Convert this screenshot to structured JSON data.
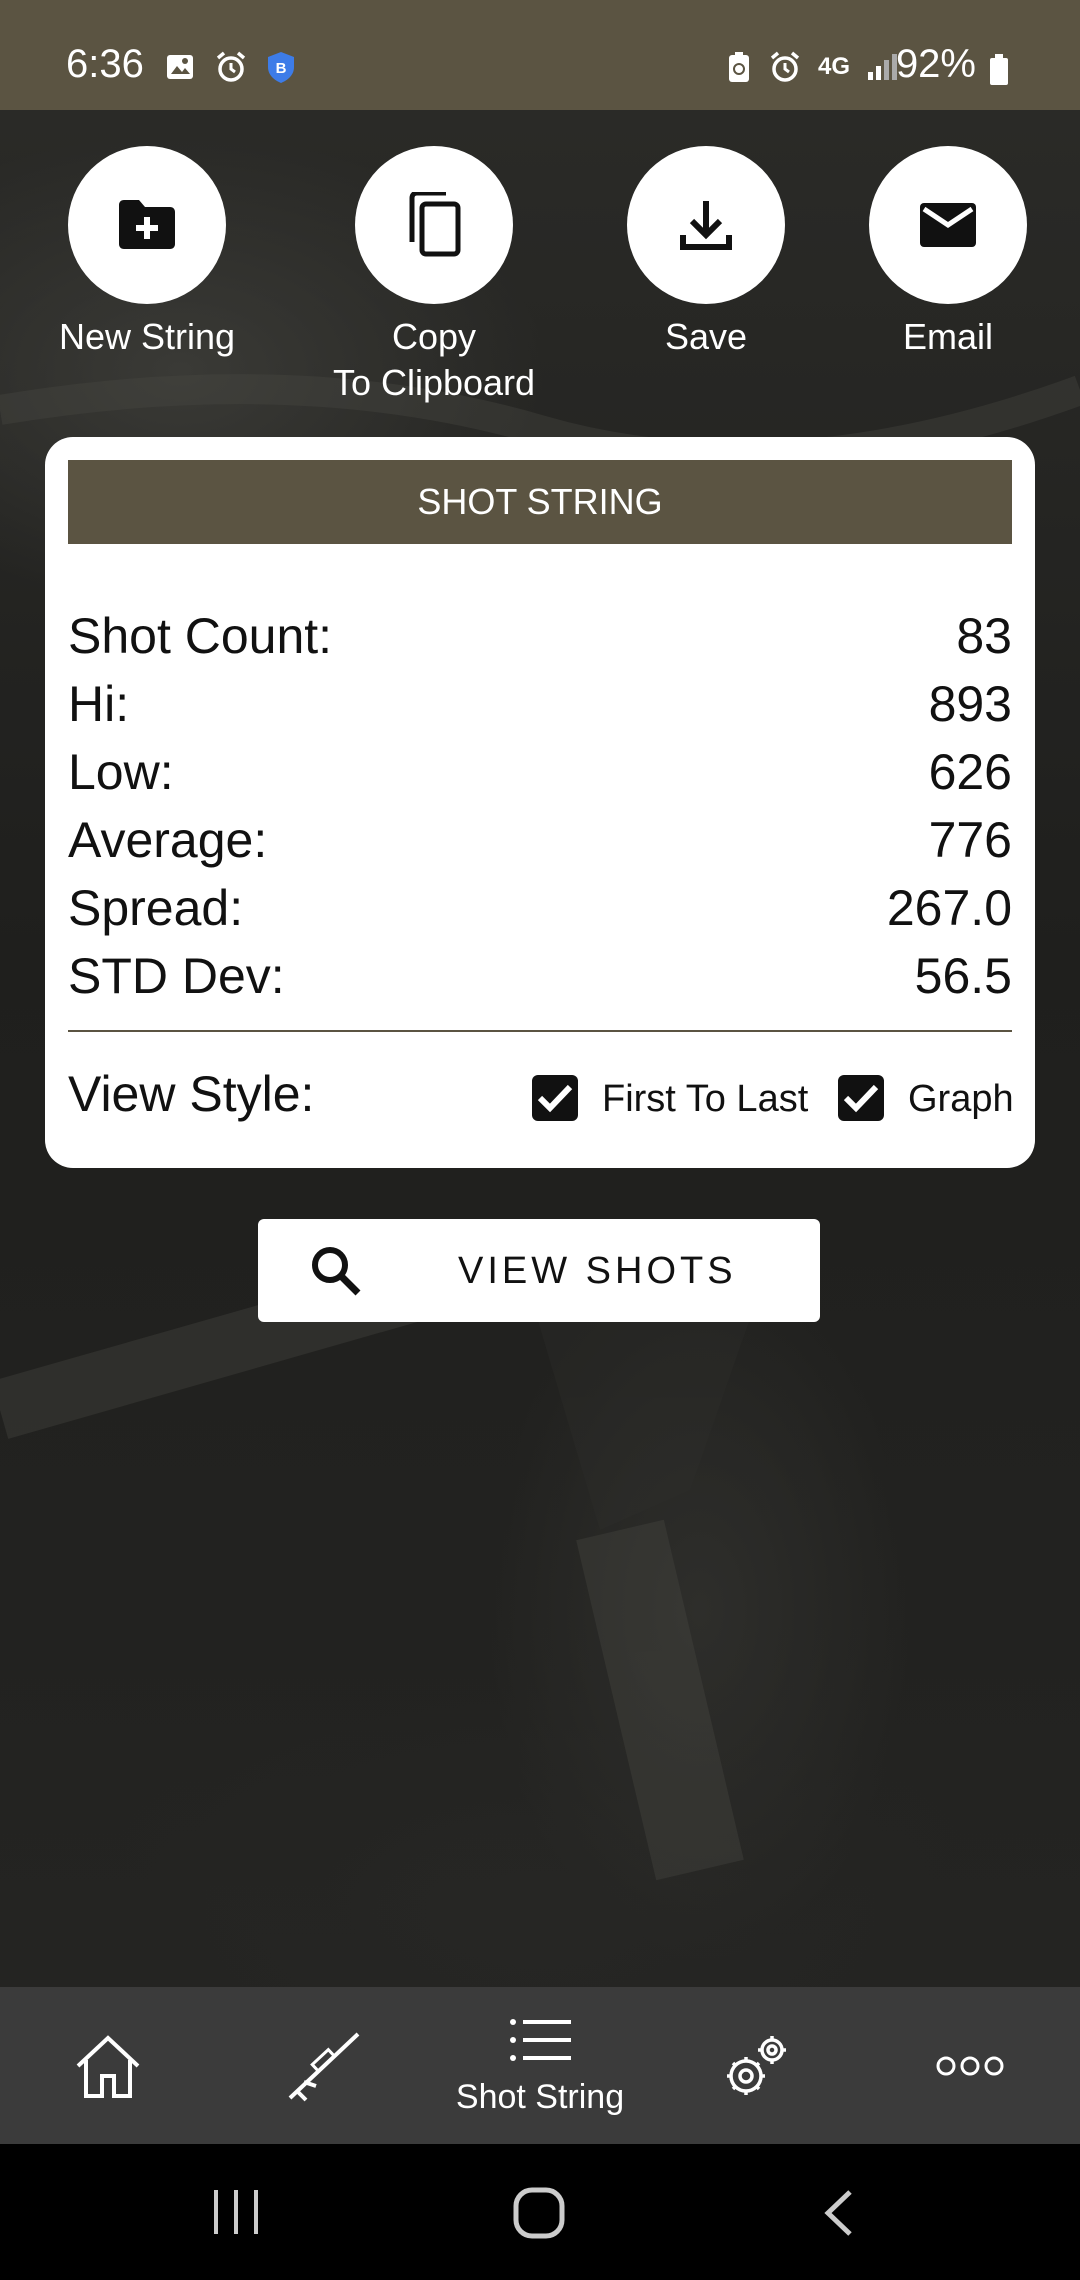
{
  "status_bar": {
    "time": "6:36",
    "battery": "92%",
    "network": "4G"
  },
  "actions": [
    {
      "label": "New String",
      "icon": "folder-plus-icon"
    },
    {
      "label": "Copy\nTo Clipboard",
      "icon": "copy-icon"
    },
    {
      "label": "Save",
      "icon": "download-icon"
    },
    {
      "label": "Email",
      "icon": "email-icon"
    }
  ],
  "card": {
    "header": "SHOT STRING",
    "stats": [
      {
        "label": "Shot Count:",
        "value": "83"
      },
      {
        "label": "Hi:",
        "value": "893"
      },
      {
        "label": "Low:",
        "value": "626"
      },
      {
        "label": "Average:",
        "value": "776"
      },
      {
        "label": "Spread:",
        "value": "267.0"
      },
      {
        "label": "STD Dev:",
        "value": "56.5"
      }
    ],
    "view_style_label": "View Style:",
    "options": [
      {
        "label": "First To Last",
        "checked": true
      },
      {
        "label": "Graph",
        "checked": true
      }
    ]
  },
  "view_shots_button": "VIEW SHOTS",
  "bottom_nav": {
    "items": [
      {
        "name": "home",
        "icon": "home-icon",
        "label": ""
      },
      {
        "name": "rifle",
        "icon": "rifle-icon",
        "label": ""
      },
      {
        "name": "shot-string",
        "icon": "list-icon",
        "label": "Shot String",
        "active": true
      },
      {
        "name": "settings",
        "icon": "gears-icon",
        "label": ""
      },
      {
        "name": "more",
        "icon": "more-icon",
        "label": ""
      }
    ]
  },
  "colors": {
    "brand": "#5b5442",
    "nav_bg": "#3b3b3b",
    "card_bg": "#ffffff"
  }
}
